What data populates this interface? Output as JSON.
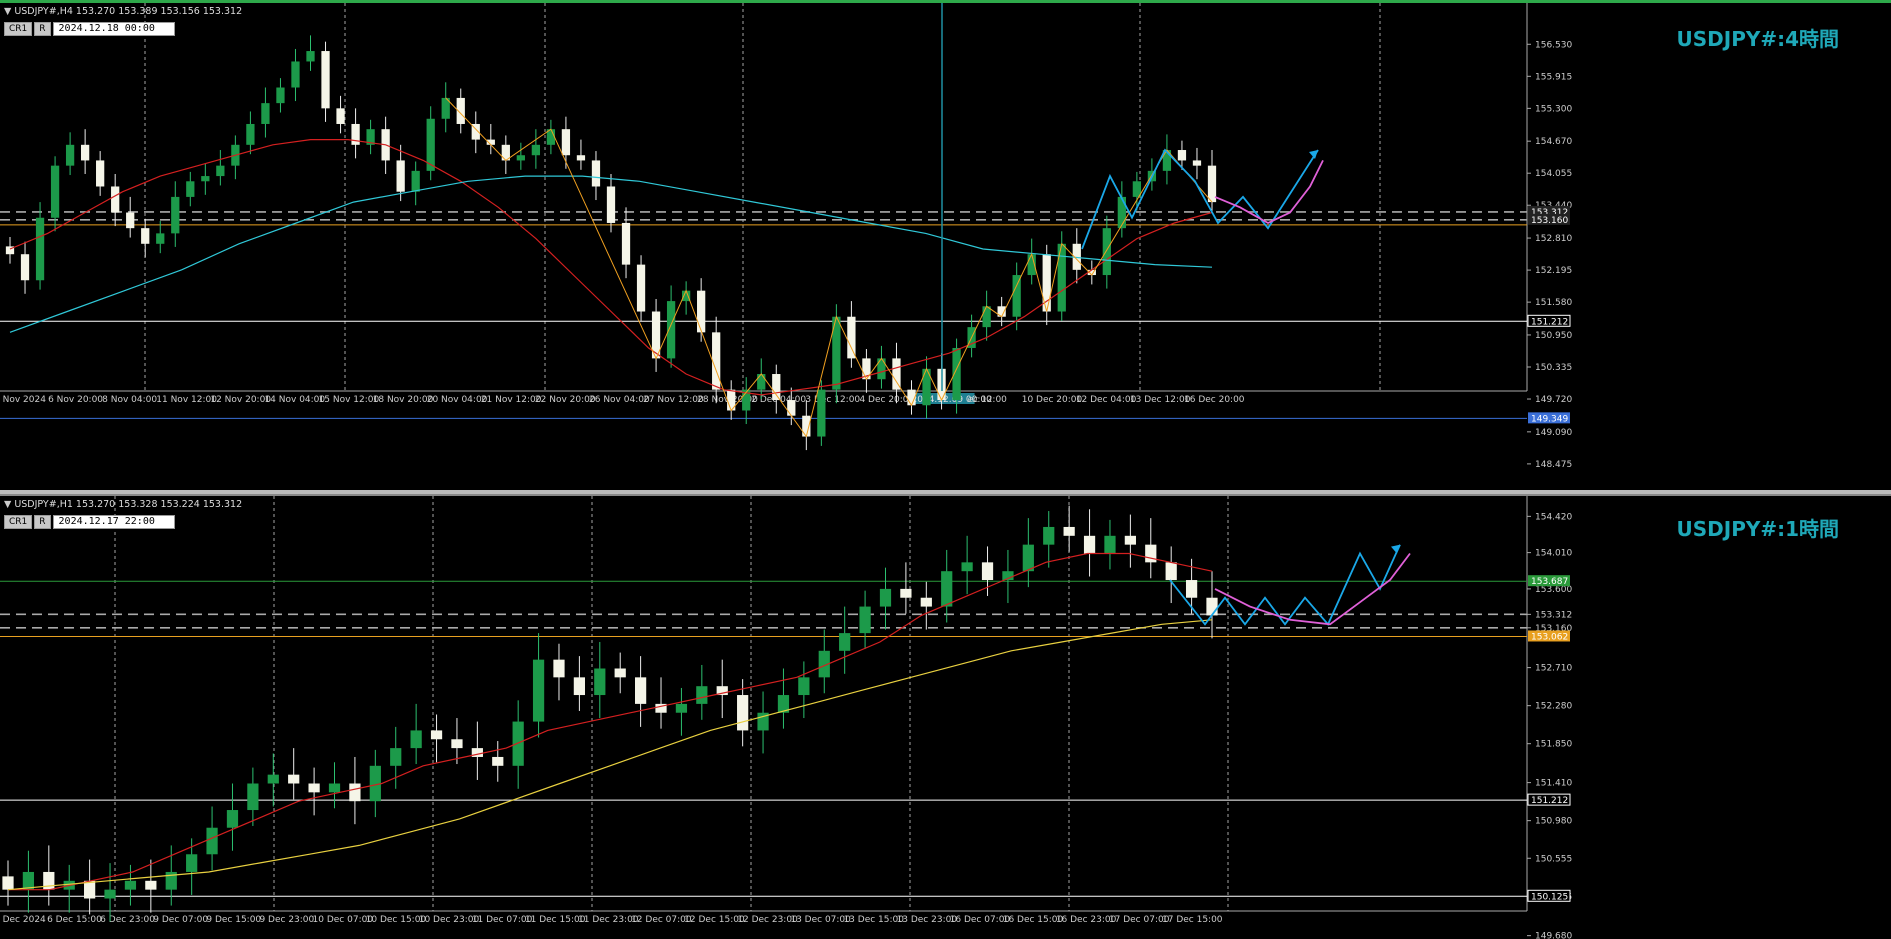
{
  "top": {
    "header": "USDJPY#,H4  153.270 153.389 153.156 153.312",
    "ctrl_label": "CR1",
    "ctrl_r": "R",
    "datetime": "2024.12.18 00:00",
    "watermark": "USDJPY#:4時間",
    "price_ticks": [
      "156.530",
      "155.915",
      "155.300",
      "154.670",
      "154.055",
      "153.440",
      "152.810",
      "152.195",
      "151.580",
      "150.950",
      "150.335",
      "149.720",
      "149.090",
      "148.475"
    ],
    "price_range": [
      148.3,
      156.9
    ],
    "time_labels": [
      "5 Nov 2024",
      "6 Nov 20:00",
      "8 Nov 04:00",
      "11 Nov 12:00",
      "12 Nov 20:00",
      "14 Nov 04:00",
      "15 Nov 12:00",
      "18 Nov 20:00",
      "20 Nov 04:00",
      "21 Nov 12:00",
      "22 Nov 20:00",
      "26 Nov 04:00",
      "27 Nov 12:00",
      "28 Nov 20:00",
      "2 Dec 04:00",
      "3 Dec 12:00",
      "4 Dec 20:00",
      "2024.12.09 00:00",
      "ec 12:00",
      "10 Dec 20:00",
      "12 Dec 04:00",
      "13 Dec 12:00",
      "16 Dec 20:00"
    ],
    "hlines": [
      {
        "price": 153.312,
        "color": "#aaaaaa",
        "dashed": true,
        "label": "153.312"
      },
      {
        "price": 153.16,
        "color": "#aaaaaa",
        "dashed": true,
        "label": "153.160"
      },
      {
        "price": 153.062,
        "color": "#e8a020",
        "dashed": false,
        "label": ""
      },
      {
        "price": 151.212,
        "color": "#ffffff",
        "dashed": false,
        "label": "151.212"
      },
      {
        "price": 149.349,
        "color": "#3a6fd8",
        "dashed": false,
        "label": "149.349"
      }
    ],
    "cursor_time_label": "2024.12.09 00:00"
  },
  "bottom": {
    "header": "USDJPY#,H1  153.270 153.328 153.224 153.312",
    "ctrl_label": "CR1",
    "ctrl_r": "R",
    "datetime": "2024.12.17 22:00",
    "watermark": "USDJPY#:1時間",
    "price_ticks": [
      "154.420",
      "154.010",
      "153.600",
      "153.312",
      "153.160",
      "152.710",
      "152.280",
      "151.850",
      "151.410",
      "150.980",
      "150.555",
      "150.125",
      "149.680"
    ],
    "price_range": [
      149.45,
      154.65
    ],
    "time_labels": [
      "5 Dec 2024",
      "6 Dec 15:00",
      "6 Dec 23:00",
      "9 Dec 07:00",
      "9 Dec 15:00",
      "9 Dec 23:00",
      "10 Dec 07:00",
      "10 Dec 15:00",
      "10 Dec 23:00",
      "11 Dec 07:00",
      "11 Dec 15:00",
      "11 Dec 23:00",
      "12 Dec 07:00",
      "12 Dec 15:00",
      "12 Dec 23:00",
      "13 Dec 07:00",
      "13 Dec 15:00",
      "13 Dec 23:00",
      "16 Dec 07:00",
      "16 Dec 15:00",
      "16 Dec 23:00",
      "17 Dec 07:00",
      "17 Dec 15:00"
    ],
    "hlines": [
      {
        "price": 153.687,
        "color": "#2a9a3a",
        "dashed": false,
        "label": "153.687"
      },
      {
        "price": 153.312,
        "color": "#aaaaaa",
        "dashed": true,
        "label": ""
      },
      {
        "price": 153.16,
        "color": "#aaaaaa",
        "dashed": true,
        "label": ""
      },
      {
        "price": 153.062,
        "color": "#e8a020",
        "dashed": false,
        "label": "153.062"
      },
      {
        "price": 151.212,
        "color": "#ffffff",
        "dashed": false,
        "label": "151.212"
      },
      {
        "price": 150.125,
        "color": "#ffffff",
        "dashed": false,
        "label": "150.125"
      }
    ]
  },
  "chart_data": [
    {
      "type": "candlestick",
      "title": "USDJPY#:4時間",
      "series_close": [
        152.5,
        152.0,
        153.2,
        154.2,
        154.6,
        154.3,
        153.8,
        153.3,
        153.0,
        152.7,
        152.9,
        153.6,
        153.9,
        154.0,
        154.2,
        154.6,
        155.0,
        155.4,
        155.7,
        156.2,
        156.4,
        155.3,
        155.0,
        154.6,
        154.9,
        154.3,
        153.7,
        154.1,
        155.1,
        155.5,
        155.0,
        154.7,
        154.6,
        154.3,
        154.4,
        154.6,
        154.9,
        154.4,
        154.3,
        153.8,
        153.1,
        152.3,
        151.4,
        150.5,
        151.6,
        151.8,
        151.0,
        149.9,
        149.5,
        149.9,
        150.2,
        149.7,
        149.4,
        149.0,
        149.9,
        151.3,
        150.5,
        150.1,
        150.5,
        149.9,
        149.6,
        150.3,
        149.7,
        150.7,
        151.1,
        151.5,
        151.3,
        152.1,
        152.5,
        151.4,
        152.7,
        152.2,
        152.1,
        153.0,
        153.6,
        153.9,
        154.1,
        154.5,
        154.3,
        154.2,
        153.5
      ],
      "ma_red": [
        152.6,
        152.9,
        153.3,
        153.7,
        154.0,
        154.2,
        154.4,
        154.6,
        154.7,
        154.7,
        154.6,
        154.3,
        153.9,
        153.4,
        152.8,
        152.1,
        151.4,
        150.7,
        150.2,
        149.9,
        149.8,
        149.9,
        150.0,
        150.2,
        150.4,
        150.6,
        150.9,
        151.3,
        151.8,
        152.3,
        152.8,
        153.1,
        153.3
      ],
      "ma_cyan": [
        151.0,
        151.4,
        151.8,
        152.2,
        152.7,
        153.1,
        153.5,
        153.7,
        153.9,
        154.0,
        154.0,
        153.9,
        153.7,
        153.5,
        153.3,
        153.1,
        152.9,
        152.6,
        152.5,
        152.4,
        152.3,
        152.25
      ],
      "forecast_note": ""
    },
    {
      "type": "candlestick",
      "title": "USDJPY#:1時間",
      "series_close": [
        150.2,
        150.4,
        150.2,
        150.3,
        150.1,
        150.2,
        150.3,
        150.2,
        150.4,
        150.6,
        150.9,
        151.1,
        151.4,
        151.5,
        151.4,
        151.3,
        151.4,
        151.2,
        151.6,
        151.8,
        152.0,
        151.9,
        151.8,
        151.7,
        151.6,
        152.1,
        152.8,
        152.6,
        152.4,
        152.7,
        152.6,
        152.3,
        152.2,
        152.3,
        152.5,
        152.4,
        152.0,
        152.2,
        152.4,
        152.6,
        152.9,
        153.1,
        153.4,
        153.6,
        153.5,
        153.4,
        153.8,
        153.9,
        153.7,
        153.8,
        154.1,
        154.3,
        154.2,
        154.0,
        154.2,
        154.1,
        153.9,
        153.7,
        153.5,
        153.3
      ],
      "ma_red": [
        150.2,
        150.2,
        150.3,
        150.4,
        150.6,
        150.8,
        151.0,
        151.2,
        151.3,
        151.4,
        151.6,
        151.7,
        151.8,
        152.0,
        152.1,
        152.2,
        152.3,
        152.4,
        152.5,
        152.6,
        152.8,
        153.0,
        153.3,
        153.5,
        153.7,
        153.9,
        154.0,
        154.0,
        153.9,
        153.8
      ],
      "ma_yellow": [
        150.2,
        150.25,
        150.3,
        150.35,
        150.4,
        150.5,
        150.6,
        150.7,
        150.85,
        151.0,
        151.2,
        151.4,
        151.6,
        151.8,
        152.0,
        152.15,
        152.3,
        152.45,
        152.6,
        152.75,
        152.9,
        153.0,
        153.1,
        153.2,
        153.25
      ]
    }
  ],
  "icons": {
    "collapse": "collapse-triangle-icon"
  }
}
